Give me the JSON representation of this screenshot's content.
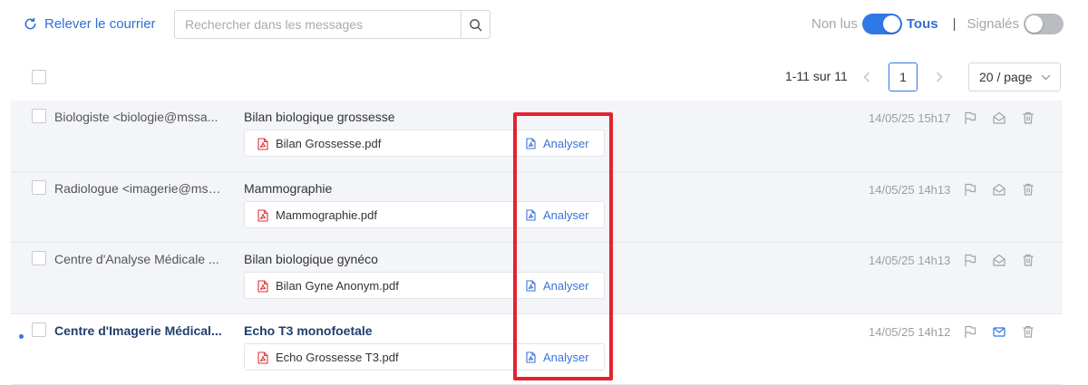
{
  "toolbar": {
    "refresh_label": "Relever le courrier",
    "search_placeholder": "Rechercher dans les messages",
    "filter_unread_label": "Non lus",
    "filter_all_label": "Tous",
    "separator": "|",
    "flagged_label": "Signalés",
    "unread_toggle_on": true,
    "flagged_toggle_on": false
  },
  "pagination": {
    "range": "1-11 sur 11",
    "current_page": "1",
    "page_size": "20 / page"
  },
  "colors": {
    "accent": "#2f78e8",
    "link": "#2f6fd6",
    "highlight": "#e4222f",
    "pdf": "#d9363e"
  },
  "messages": [
    {
      "sender": "Biologiste <biologie@mssa...",
      "subject": "Bilan biologique grossesse",
      "attachment": "Bilan Grossesse.pdf",
      "analyze_label": "Analyser",
      "date": "14/05/25 15h17",
      "unread": false
    },
    {
      "sender": "Radiologue <imagerie@mss...",
      "subject": "Mammographie",
      "attachment": "Mammographie.pdf",
      "analyze_label": "Analyser",
      "date": "14/05/25 14h13",
      "unread": false
    },
    {
      "sender": "Centre d'Analyse Médicale ...",
      "subject": "Bilan biologique gynéco",
      "attachment": "Bilan Gyne Anonym.pdf",
      "analyze_label": "Analyser",
      "date": "14/05/25 14h13",
      "unread": false
    },
    {
      "sender": "Centre d'Imagerie Médical...",
      "subject": "Echo T3 monofoetale",
      "attachment": "Echo Grossesse T3.pdf",
      "analyze_label": "Analyser",
      "date": "14/05/25 14h12",
      "unread": true
    }
  ],
  "icons": {
    "refresh": "refresh-icon",
    "search": "search-icon",
    "prev": "chevron-left-icon",
    "next": "chevron-right-icon",
    "dropdown": "chevron-down-icon",
    "pdf": "pdf-file-icon",
    "analyze": "document-analyze-icon",
    "flag": "flag-icon",
    "read_mail": "envelope-open-icon",
    "unread_mail": "envelope-icon",
    "delete": "trash-icon"
  }
}
